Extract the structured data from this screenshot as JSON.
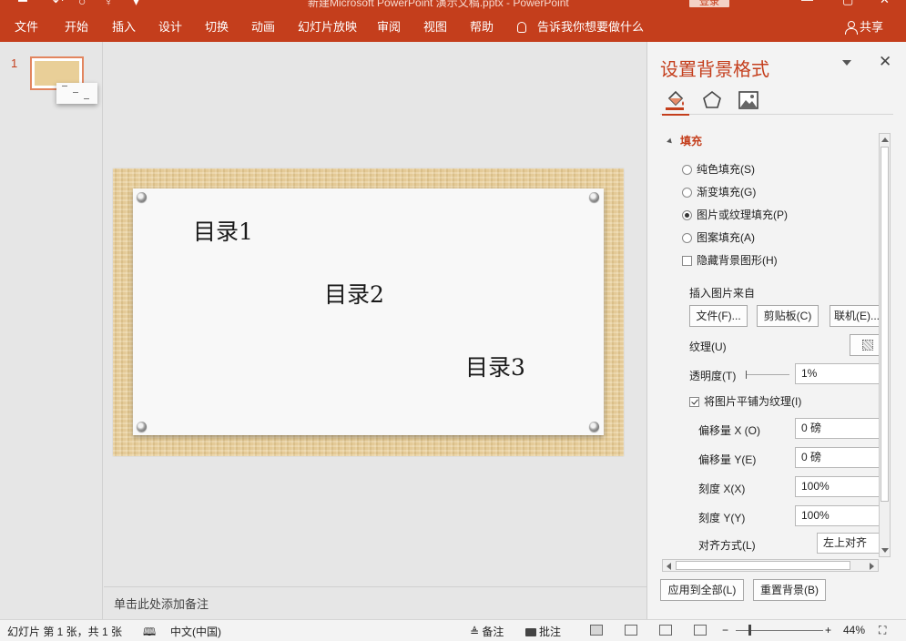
{
  "titlebar": {
    "doc_title": "新建Microsoft PowerPoint 演示文稿.pptx - PowerPoint",
    "login_label": "登录"
  },
  "ribbon": {
    "tabs": [
      "文件",
      "开始",
      "插入",
      "设计",
      "切换",
      "动画",
      "幻灯片放映",
      "审阅",
      "视图",
      "帮助"
    ],
    "tell_me": "告诉我你想要做什么",
    "share": "共享"
  },
  "thumbnails": {
    "slide_number": "1"
  },
  "slide": {
    "items": [
      "目录1",
      "目录2",
      "目录3"
    ]
  },
  "notes": {
    "placeholder": "单击此处添加备注"
  },
  "pane": {
    "title": "设置背景格式",
    "section_fill": "填充",
    "radio_solid": "纯色填充(S)",
    "radio_gradient": "渐变填充(G)",
    "radio_picture": "图片或纹理填充(P)",
    "radio_pattern": "图案填充(A)",
    "check_hide": "隐藏背景图形(H)",
    "insert_from": "插入图片来自",
    "btn_file": "文件(F)...",
    "btn_clipboard": "剪贴板(C)",
    "btn_online": "联机(E)...",
    "texture_label": "纹理(U)",
    "transparency_label": "透明度(T)",
    "transparency_value": "1%",
    "tile_label": "将图片平铺为纹理(I)",
    "offset_x_label": "偏移量 X (O)",
    "offset_x_value": "0 磅",
    "offset_y_label": "偏移量 Y(E)",
    "offset_y_value": "0 磅",
    "scale_x_label": "刻度 X(X)",
    "scale_x_value": "100%",
    "scale_y_label": "刻度 Y(Y)",
    "scale_y_value": "100%",
    "align_label": "对齐方式(L)",
    "align_value": "左上对齐",
    "apply_all": "应用到全部(L)",
    "reset": "重置背景(B)"
  },
  "status": {
    "slide_info": "幻灯片 第 1 张，共 1 张",
    "language": "中文(中国)",
    "notes": "备注",
    "comments": "批注",
    "zoom": "44%"
  },
  "colors": {
    "accent": "#c43e1c",
    "wood": "#e8cd95"
  }
}
